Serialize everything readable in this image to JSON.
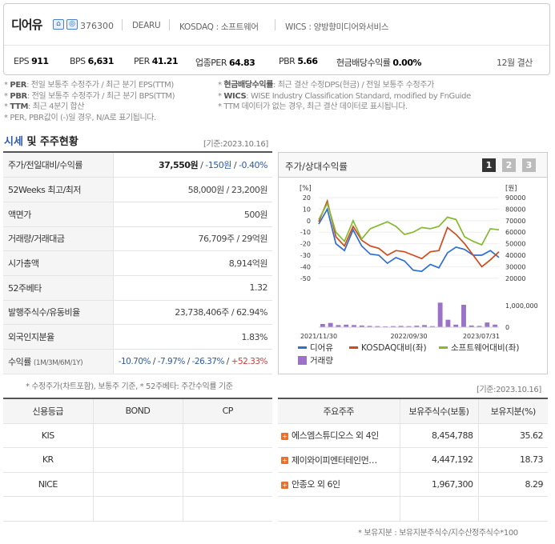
{
  "header": {
    "name": "디어유",
    "code": "376300",
    "eng_name": "DEARU",
    "market": "KOSDAQ : 소프트웨어",
    "wics": "WICS : 양방향미디어와서비스",
    "settle": "12월 결산",
    "metrics": [
      {
        "label": "EPS",
        "value": "911"
      },
      {
        "label": "BPS",
        "value": "6,631"
      },
      {
        "label": "PER",
        "value": "41.21"
      },
      {
        "label": "업종PER",
        "value": "64.83"
      },
      {
        "label": "PBR",
        "value": "5.66"
      },
      {
        "label": "현금배당수익률",
        "value": "0.00%"
      }
    ]
  },
  "notes": {
    "per_k": "PER",
    "per_t": ": 전일 보통주 수정주가 / 최근 분기 EPS(TTM)",
    "pbr_k": "PBR",
    "pbr_t": ": 전일 보통주 수정주가 / 최근 분기 BPS(TTM)",
    "ttm_k": "TTM",
    "ttm_t": ": 최근 4분기 합산",
    "neg": "* PER, PBR값이 (-)일 경우, N/A로 표기됩니다.",
    "div_k": "현금배당수익률",
    "div_t": ": 최근 결산 수정DPS(현금) / 전일 보통주 수정주가",
    "wics_k": "WICS",
    "wics_t": ": WISE Industry Classification Standard, modified by FnGuide",
    "ttm_none": "* TTM 데이터가 없는 경우, 최근 결산 데이터로 표시됩니다."
  },
  "section": {
    "title_a": "시세",
    "title_b": " 및 주주현황",
    "base_date": "[기준:2023.10.16]"
  },
  "quote": [
    {
      "k": "주가/전일대비/수익률",
      "v1": "37,550원",
      "v2": "-150원",
      "v3": "-0.40%"
    },
    {
      "k": "52Weeks 최고/최저",
      "v": "58,000원 / 23,200원"
    },
    {
      "k": "액면가",
      "v": "500원"
    },
    {
      "k": "거래량/거래대금",
      "v": "76,709주 / 29억원"
    },
    {
      "k": "시가총액",
      "v": "8,914억원"
    },
    {
      "k": "52주베타",
      "v": "1.32"
    },
    {
      "k": "발행주식수/유동비율",
      "v": "23,738,406주 / 62.94%"
    },
    {
      "k": "외국인지분율",
      "v": "1.83%"
    }
  ],
  "returns": {
    "k": "수익률",
    "k2": "(1M/3M/6M/1Y)",
    "r1": "-10.70%",
    "r2": "-7.97%",
    "r3": "-26.37%",
    "r4": "+52.33%"
  },
  "quote_note": "* 수정주가(차트포함), 보통주 기준, * 52주베타: 주간수익률 기준",
  "chart_panel": {
    "title": "주가/상대수익률",
    "pages": [
      "1",
      "2",
      "3"
    ]
  },
  "chart_data": {
    "type": "line",
    "left_unit": "[%]",
    "right_unit": "[원]",
    "left_ticks": [
      "20",
      "10",
      "0",
      "-10",
      "-20",
      "-30",
      "-40",
      "-50"
    ],
    "right_ticks": [
      "90000",
      "80000",
      "70000",
      "60000",
      "50000",
      "40000",
      "30000",
      "20000"
    ],
    "vol_ticks": [
      "1,000,000",
      "0"
    ],
    "x_ticks": [
      "2021/11/30",
      "2022/09/30",
      "2023/07/31"
    ],
    "ylim": [
      -50,
      20
    ],
    "series": [
      {
        "name": "디어유",
        "color": "#2f6fd0",
        "values": [
          -3,
          10,
          -20,
          -26,
          -8,
          -22,
          -29,
          -30,
          -37,
          -32,
          -35,
          -43,
          -44,
          -38,
          -41,
          -28,
          -23,
          -25,
          -30,
          -30,
          -26,
          -32
        ]
      },
      {
        "name": "KOSDAQ대비(좌)",
        "color": "#d04a1c",
        "values": [
          -1,
          17,
          -14,
          -22,
          -5,
          -17,
          -22,
          -24,
          -30,
          -26,
          -27,
          -30,
          -33,
          -27,
          -26,
          -6,
          -12,
          -20,
          -30,
          -40,
          -34,
          -27
        ]
      },
      {
        "name": "소프트웨어대비(좌)",
        "color": "#86b830",
        "values": [
          1,
          15,
          -10,
          -18,
          0,
          -16,
          -7,
          -4,
          -1,
          -5,
          -12,
          -10,
          -6,
          -7,
          -5,
          3,
          1,
          -14,
          -18,
          -21,
          -7,
          -8
        ]
      }
    ],
    "volume": {
      "name": "거래량",
      "color": "#9b72c8",
      "values": [
        0.15,
        0.2,
        0.1,
        0.12,
        0.1,
        0.08,
        0.06,
        0.05,
        0.04,
        0.05,
        0.06,
        0.05,
        0.07,
        0.1,
        0.05,
        1.15,
        0.35,
        0.12,
        1.05,
        0.08,
        0.06,
        0.22,
        0.12
      ]
    }
  },
  "credit": {
    "headers": [
      "신용등급",
      "BOND",
      "CP"
    ],
    "rows": [
      "KIS",
      "KR",
      "NICE",
      ""
    ]
  },
  "holders": {
    "base_date": "[기준:2023.10.16]",
    "headers": [
      "주요주주",
      "보유주식수(보통)",
      "보유지분(%)"
    ],
    "rows": [
      {
        "name": "에스엠스튜디오스 외 4인",
        "shares": "8,454,788",
        "pct": "35.62"
      },
      {
        "name": "제이와이피엔터테인먼…",
        "shares": "4,447,192",
        "pct": "18.73"
      },
      {
        "name": "안종오 외 6인",
        "shares": "1,967,300",
        "pct": "8.29"
      }
    ],
    "note": "* 보유지분 : 보유지분주식수/지수산정주식수*100"
  },
  "colors": {
    "accent": "#2b5ba8",
    "down": "#2b5ba8",
    "up": "#d23a3a",
    "bullet": "#e8702a"
  }
}
